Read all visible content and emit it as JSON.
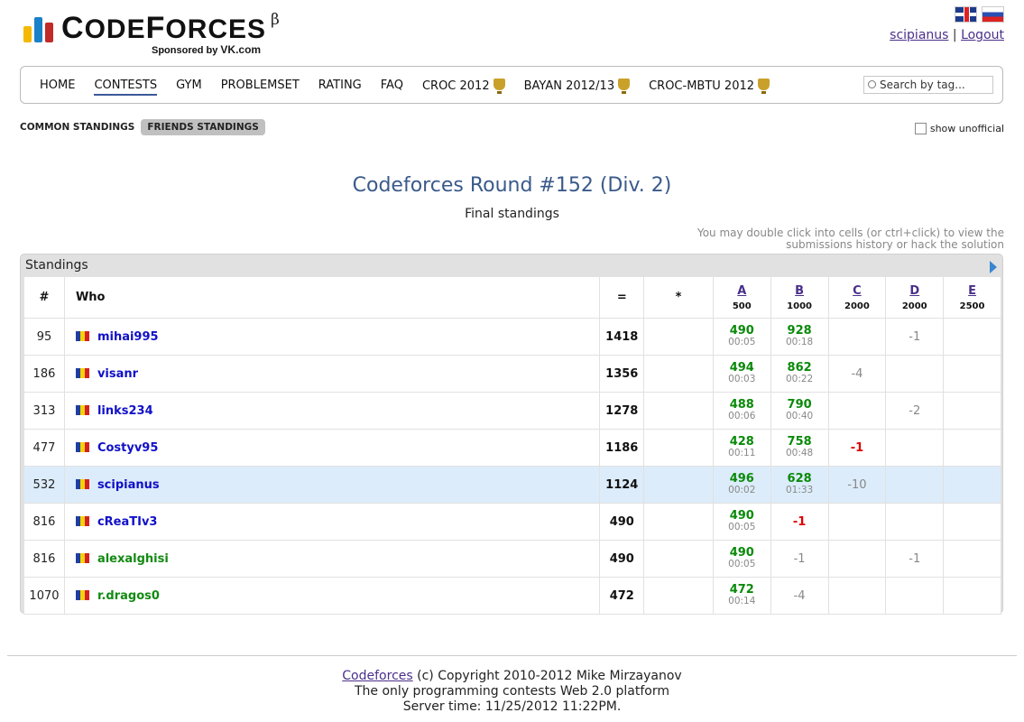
{
  "brand": {
    "name_cap": "C",
    "name_rest": "ODE",
    "name_cap2": "F",
    "name_rest2": "ORCES",
    "beta": "β",
    "sponsor_prefix": "Sponsored by",
    "sponsor_name": "VK.com"
  },
  "user": {
    "handle": "scipianus",
    "separator": "|",
    "logout": "Logout"
  },
  "menu": [
    {
      "label": "HOME",
      "active": false
    },
    {
      "label": "CONTESTS",
      "active": true
    },
    {
      "label": "GYM",
      "active": false
    },
    {
      "label": "PROBLEMSET",
      "active": false
    },
    {
      "label": "RATING",
      "active": false
    },
    {
      "label": "FAQ",
      "active": false
    },
    {
      "label": "CROC 2012",
      "active": false,
      "trophy": true
    },
    {
      "label": "BAYAN 2012/13",
      "active": false,
      "trophy": true
    },
    {
      "label": "CROC-MBTU 2012",
      "active": false,
      "trophy": true
    }
  ],
  "search": {
    "placeholder": "Search by tag..."
  },
  "subnav": {
    "common": "COMMON STANDINGS",
    "friends": "FRIENDS STANDINGS",
    "unofficial": "show unofficial"
  },
  "contest": {
    "title": "Codeforces Round #152 (Div. 2)",
    "subtitle": "Final standings",
    "hint_line1": "You may double click into cells (or ctrl+click) to view the",
    "hint_line2": "submissions history or hack the solution"
  },
  "standings": {
    "caption": "Standings",
    "headers": {
      "rank": "#",
      "who": "Who",
      "score": "=",
      "hacks": "*"
    },
    "problems": [
      {
        "letter": "A",
        "points": "500"
      },
      {
        "letter": "B",
        "points": "1000"
      },
      {
        "letter": "C",
        "points": "2000"
      },
      {
        "letter": "D",
        "points": "2000"
      },
      {
        "letter": "E",
        "points": "2500"
      }
    ],
    "rows": [
      {
        "rank": "95",
        "handle": "mihai995",
        "color": "blue",
        "score": "1418",
        "hacks": "",
        "me": false,
        "cells": [
          {
            "t": "acc",
            "v": "490",
            "time": "00:05"
          },
          {
            "t": "acc",
            "v": "928",
            "time": "00:18"
          },
          {
            "t": "empty"
          },
          {
            "t": "neg",
            "v": "-1"
          },
          {
            "t": "empty"
          }
        ]
      },
      {
        "rank": "186",
        "handle": "visanr",
        "color": "blue",
        "score": "1356",
        "hacks": "",
        "me": false,
        "cells": [
          {
            "t": "acc",
            "v": "494",
            "time": "00:03"
          },
          {
            "t": "acc",
            "v": "862",
            "time": "00:22"
          },
          {
            "t": "neg",
            "v": "-4"
          },
          {
            "t": "empty"
          },
          {
            "t": "empty"
          }
        ]
      },
      {
        "rank": "313",
        "handle": "links234",
        "color": "blue",
        "score": "1278",
        "hacks": "",
        "me": false,
        "cells": [
          {
            "t": "acc",
            "v": "488",
            "time": "00:06"
          },
          {
            "t": "acc",
            "v": "790",
            "time": "00:40"
          },
          {
            "t": "empty"
          },
          {
            "t": "neg",
            "v": "-2"
          },
          {
            "t": "empty"
          }
        ]
      },
      {
        "rank": "477",
        "handle": "Costyv95",
        "color": "blue",
        "score": "1186",
        "hacks": "",
        "me": false,
        "cells": [
          {
            "t": "acc",
            "v": "428",
            "time": "00:11"
          },
          {
            "t": "acc",
            "v": "758",
            "time": "00:48"
          },
          {
            "t": "negr",
            "v": "-1"
          },
          {
            "t": "empty"
          },
          {
            "t": "empty"
          }
        ]
      },
      {
        "rank": "532",
        "handle": "scipianus",
        "color": "blue",
        "score": "1124",
        "hacks": "",
        "me": true,
        "cells": [
          {
            "t": "acc",
            "v": "496",
            "time": "00:02"
          },
          {
            "t": "acc",
            "v": "628",
            "time": "01:33"
          },
          {
            "t": "neg",
            "v": "-10"
          },
          {
            "t": "empty"
          },
          {
            "t": "empty"
          }
        ]
      },
      {
        "rank": "816",
        "handle": "cReaTIv3",
        "color": "blue",
        "score": "490",
        "hacks": "",
        "me": false,
        "cells": [
          {
            "t": "acc",
            "v": "490",
            "time": "00:05"
          },
          {
            "t": "negr",
            "v": "-1"
          },
          {
            "t": "empty"
          },
          {
            "t": "empty"
          },
          {
            "t": "empty"
          }
        ]
      },
      {
        "rank": "816",
        "handle": "alexalghisi",
        "color": "green",
        "score": "490",
        "hacks": "",
        "me": false,
        "cells": [
          {
            "t": "acc",
            "v": "490",
            "time": "00:05"
          },
          {
            "t": "neg",
            "v": "-1"
          },
          {
            "t": "empty"
          },
          {
            "t": "neg",
            "v": "-1"
          },
          {
            "t": "empty"
          }
        ]
      },
      {
        "rank": "1070",
        "handle": "r.dragos0",
        "color": "green",
        "score": "472",
        "hacks": "",
        "me": false,
        "cells": [
          {
            "t": "acc",
            "v": "472",
            "time": "00:14"
          },
          {
            "t": "neg",
            "v": "-4"
          },
          {
            "t": "empty"
          },
          {
            "t": "empty"
          },
          {
            "t": "empty"
          }
        ]
      }
    ]
  },
  "footer": {
    "link": "Codeforces",
    "copyright": "(c) Copyright 2010-2012 Mike Mirzayanov",
    "line2": "The only programming contests Web 2.0 platform",
    "line3": "Server time: 11/25/2012 11:22PM."
  },
  "colors": {
    "accent": "#3b5998",
    "accepted": "#0a8a0a",
    "rejected_red": "#e00000",
    "highlight_row": "#dcecfa"
  }
}
